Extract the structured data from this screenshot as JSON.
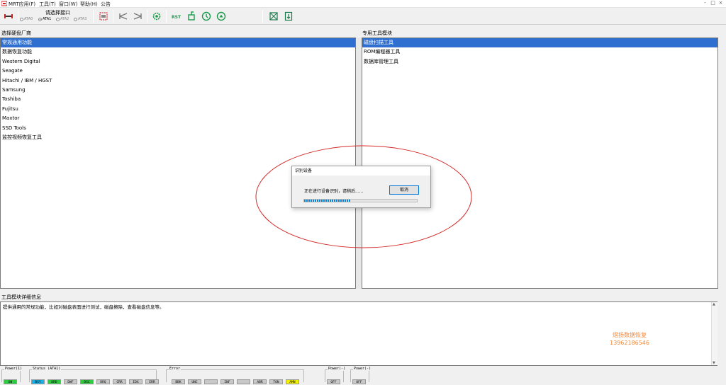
{
  "menubar": {
    "items": [
      "MRT应用(F)",
      "工具(T)",
      "窗口(W)",
      "帮助(H)",
      "公告"
    ],
    "window_controls": [
      "-",
      "□",
      "×"
    ]
  },
  "toolbar": {
    "port_label": "请选择接口",
    "ports": [
      "ATA0",
      "ATA1",
      "ATA2",
      "ATA3"
    ],
    "selected_port": "ATA1"
  },
  "left_panel": {
    "title": "选择硬盘厂商",
    "items": [
      "常规通用功能",
      "数据恢复功能",
      "Western Digital",
      "Seagate",
      "Hitachi / IBM / HGST",
      "Samsung",
      "Toshiba",
      "Fujitsu",
      "Maxtor",
      "SSD Tools",
      "监控视频恢复工具"
    ],
    "selected": "常规通用功能"
  },
  "right_panel": {
    "title": "专用工具模块",
    "items": [
      "磁盘扫描工具",
      "ROM编程器工具",
      "数据库管理工具"
    ],
    "selected": "磁盘扫描工具"
  },
  "dialog": {
    "title": "识别设备",
    "message": "正在进行设备识别，请稍后......",
    "cancel_label": "取消",
    "progress": 0.41
  },
  "detail": {
    "title": "工具模块详细信息",
    "text": "提供通用的常规功能，比如对磁盘表面进行测试，磁盘擦除，查看磁盘信息等。"
  },
  "watermark": {
    "line1": "熠扬数据恢复",
    "line2": "13962186546",
    "color": "#f28a3c"
  },
  "status": {
    "power1": {
      "label": "Power(1)",
      "leds": [
        {
          "text": "ON",
          "color": "#2ecc40"
        }
      ]
    },
    "status": {
      "label": "Status (ATA1)",
      "leds": [
        {
          "text": "BSY",
          "color": "#17b0e8"
        },
        {
          "text": "DRD",
          "color": "#2ecc40"
        },
        {
          "text": "DWF",
          "color": "#c8c8c8"
        },
        {
          "text": "DSC",
          "color": "#2ecc40"
        },
        {
          "text": "DRQ",
          "color": "#c8c8c8"
        },
        {
          "text": "CRR",
          "color": "#c8c8c8"
        },
        {
          "text": "IDX",
          "color": "#c8c8c8"
        },
        {
          "text": "ERR",
          "color": "#c8c8c8"
        }
      ]
    },
    "error": {
      "label": "Error",
      "leds": [
        {
          "text": "BBK",
          "color": "#c8c8c8"
        },
        {
          "text": "UNC",
          "color": "#c8c8c8"
        },
        {
          "text": "",
          "color": "#c8c8c8"
        },
        {
          "text": "INF",
          "color": "#c8c8c8"
        },
        {
          "text": "",
          "color": "#c8c8c8"
        },
        {
          "text": "ABR",
          "color": "#c8c8c8"
        },
        {
          "text": "TON",
          "color": "#c8c8c8"
        },
        {
          "text": "AMN",
          "color": "#f2f200"
        }
      ]
    },
    "power2": {
      "label": "Power(-)",
      "leds": [
        {
          "text": "OFF",
          "color": "#c8c8c8"
        }
      ]
    },
    "power3": {
      "label": "Power(-)",
      "leds": [
        {
          "text": "OFF",
          "color": "#c8c8c8"
        }
      ]
    }
  },
  "icons": [
    "disk-icon",
    "write-arrows-icon",
    "read-arrows-icon",
    "settings-icon",
    "reset-icon",
    "device-icon",
    "refresh-icon",
    "power-icon",
    "chip-icon",
    "export-icon"
  ],
  "colors": {
    "selection": "#2f6fd0",
    "highlight_circle": "#d42a2a"
  }
}
